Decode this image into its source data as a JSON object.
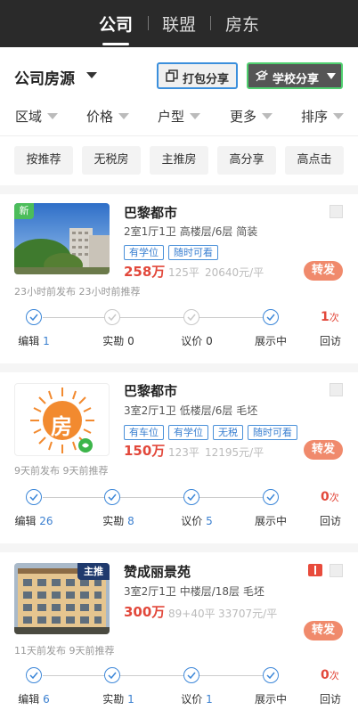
{
  "header": {
    "tabs": [
      {
        "label": "公司",
        "active": true
      },
      {
        "label": "联盟",
        "active": false
      },
      {
        "label": "房东",
        "active": false
      }
    ],
    "bg_color": "#2a2a2a"
  },
  "toolbar": {
    "title": "公司房源",
    "pack_share_label": "打包分享",
    "school_share_label": "学校分享"
  },
  "filters": [
    "区域",
    "价格",
    "户型",
    "更多",
    "排序"
  ],
  "quick_tags": [
    "按推荐",
    "无税房",
    "主推房",
    "高分享",
    "高点击"
  ],
  "listings": [
    {
      "thumb_badge": "新",
      "name": "巴黎都市",
      "info": "2室1厅1卫  高楼层/6层  简装",
      "tags": [
        "有学位",
        "随时可看"
      ],
      "price": "258万",
      "area": "125平",
      "unit_price": "20640元/平",
      "forward_label": "转发",
      "posted": "23小时前发布  23小时前推荐",
      "steps": {
        "edit": {
          "label": "编辑",
          "count": "1",
          "active": true
        },
        "survey": {
          "label": "实勘",
          "count": "0",
          "active": false
        },
        "bargain": {
          "label": "议价",
          "count": "0",
          "active": false
        },
        "display": {
          "label": "展示中",
          "active": true
        }
      },
      "visit_count": "1",
      "visit_unit": "次",
      "visit_label": "回访"
    },
    {
      "thumb_badge": "",
      "name": "巴黎都市",
      "info": "3室2厅1卫  低楼层/6层  毛坯",
      "tags": [
        "有车位",
        "有学位",
        "无税",
        "随时可看"
      ],
      "price": "150万",
      "area": "123平",
      "unit_price": "12195元/平",
      "forward_label": "转发",
      "posted": "9天前发布  9天前推荐",
      "thumb_char": "房",
      "steps": {
        "edit": {
          "label": "编辑",
          "count": "26",
          "active": true
        },
        "survey": {
          "label": "实勘",
          "count": "8",
          "active": true
        },
        "bargain": {
          "label": "议价",
          "count": "5",
          "active": true
        },
        "display": {
          "label": "展示中",
          "active": true
        }
      },
      "visit_count": "0",
      "visit_unit": "次",
      "visit_label": "回访"
    },
    {
      "thumb_badge": "主推",
      "name": "赞成丽景苑",
      "info": "3室2厅1卫  中楼层/18层  毛坯",
      "tags": [],
      "price": "300万",
      "area": "89+40平",
      "unit_price": "33707元/平",
      "forward_label": "转发",
      "posted": "11天前发布  9天前推荐",
      "steps": {
        "edit": {
          "label": "编辑",
          "count": "6",
          "active": true
        },
        "survey": {
          "label": "实勘",
          "count": "1",
          "active": true
        },
        "bargain": {
          "label": "议价",
          "count": "1",
          "active": true
        },
        "display": {
          "label": "展示中",
          "active": true
        }
      },
      "visit_count": "0",
      "visit_unit": "次",
      "visit_label": "回访"
    }
  ],
  "colors": {
    "accent_blue": "#3b86d8",
    "price_red": "#e2483b",
    "forward_orange": "#f08a6c",
    "school_border_green": "#4fcf6f"
  }
}
